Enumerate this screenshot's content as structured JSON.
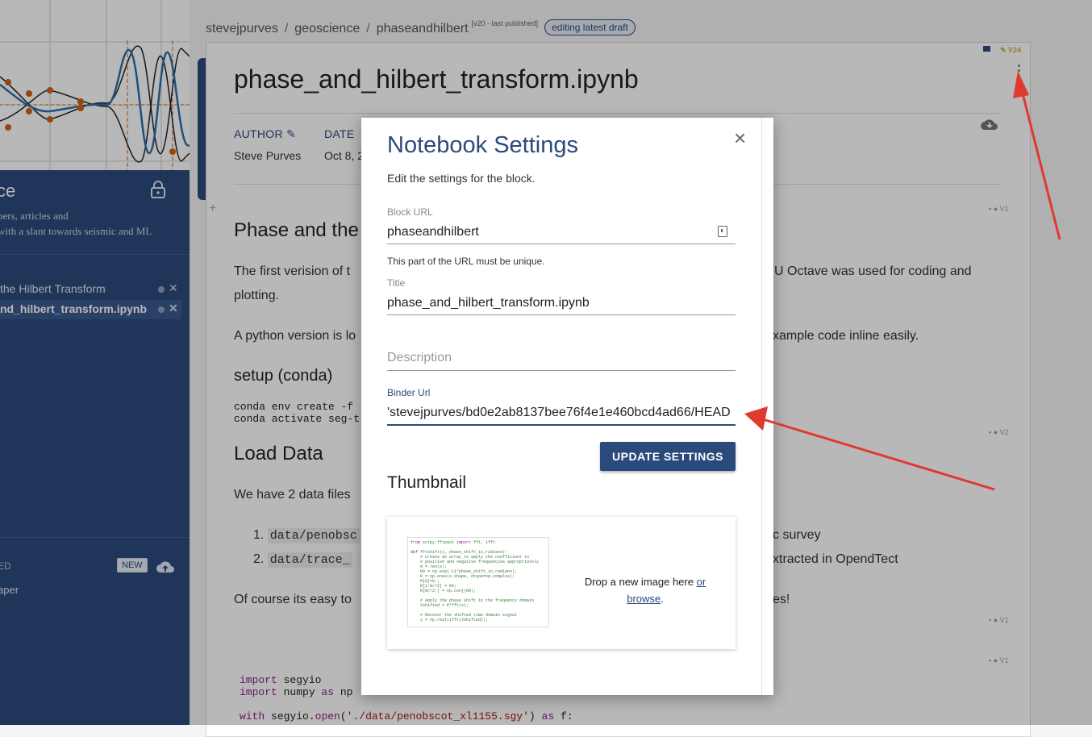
{
  "sidebar": {
    "title_fragment": "ce",
    "desc_line1": "pers, articles and",
    "desc_line2": "with a slant towards seismic and ML",
    "items": [
      {
        "label": " the Hilbert Transform"
      },
      {
        "label": "nd_hilbert_transform.ipynb"
      }
    ],
    "published_label": "ED",
    "new_label": "NEW",
    "paper_label": "aper"
  },
  "breadcrumb": {
    "user": "stevejpurves",
    "project": "geoscience",
    "block": "phaseandhilbert",
    "version": "[v20 - last published]",
    "badge": "editing latest draft"
  },
  "doc": {
    "version_tag": "V24",
    "title": "phase_and_hilbert_transform.ipynb",
    "author_label": "AUTHOR",
    "author_name": "Steve Purves",
    "date_label": "DATE",
    "date_value": "Oct 8, 2",
    "h_phase": "Phase and the",
    "p1a": "The first verision of t",
    "p1b": "U Octave was used for coding and",
    "p1c": "plotting.",
    "p2a": "A python version is lo",
    "p2b": "xample code inline easily.",
    "h_setup": "setup (conda)",
    "code_setup": "conda env create -f \nconda activate seg-t",
    "h_load": "Load Data",
    "p3": "We have 2 data files",
    "li1": "data/penobsc",
    "li1b": "c survey",
    "li2": "data/trace_",
    "li2b": "xtracted in OpendTect",
    "p4a": "Of course its easy to",
    "p4b": "es!",
    "code_import": "import segyio\nimport numpy as np\n\nwith segyio.open('./data/penobscot_xl1155.sgy') as f:",
    "tick_v1": "V1",
    "tick_v2": "V2"
  },
  "modal": {
    "title": "Notebook Settings",
    "subtitle": "Edit the settings for the block.",
    "block_url_label": "Block URL",
    "block_url_value": "phaseandhilbert",
    "block_url_help": "This part of the URL must be unique.",
    "title_label": "Title",
    "title_value": "phase_and_hilbert_transform.ipynb",
    "description_placeholder": "Description",
    "binder_label": "Binder Url",
    "binder_value": "'stevejpurves/bd0e2ab8137bee76f4e1e460bcd4ad66/HEAD",
    "update_button": "UPDATE SETTINGS",
    "thumbnail_heading": "Thumbnail",
    "drop_text": "Drop a new image here ",
    "drop_or": "or",
    "drop_browse": "browse",
    "drop_end": ".",
    "close_glyph": "×"
  },
  "colors": {
    "accent": "#2b4a7c",
    "annotation_arrow": "#e03a2f"
  }
}
